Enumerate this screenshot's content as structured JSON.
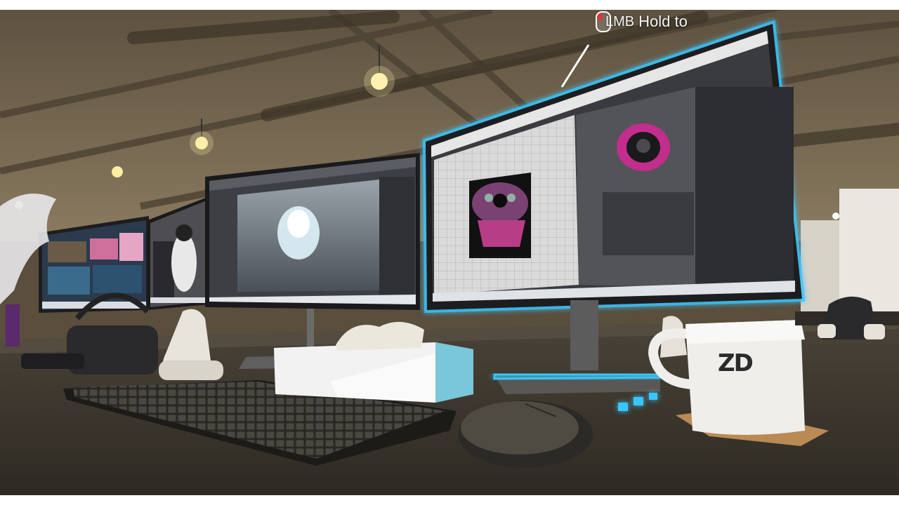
{
  "hint": {
    "button": "LMB",
    "text": "Hold to",
    "icon": "mouse-left-button-icon"
  },
  "mug": {
    "logo": "ZD"
  },
  "colors": {
    "accent_glow": "#39c6ff",
    "ceiling": "#6e6048",
    "desk": "#3b352c"
  }
}
